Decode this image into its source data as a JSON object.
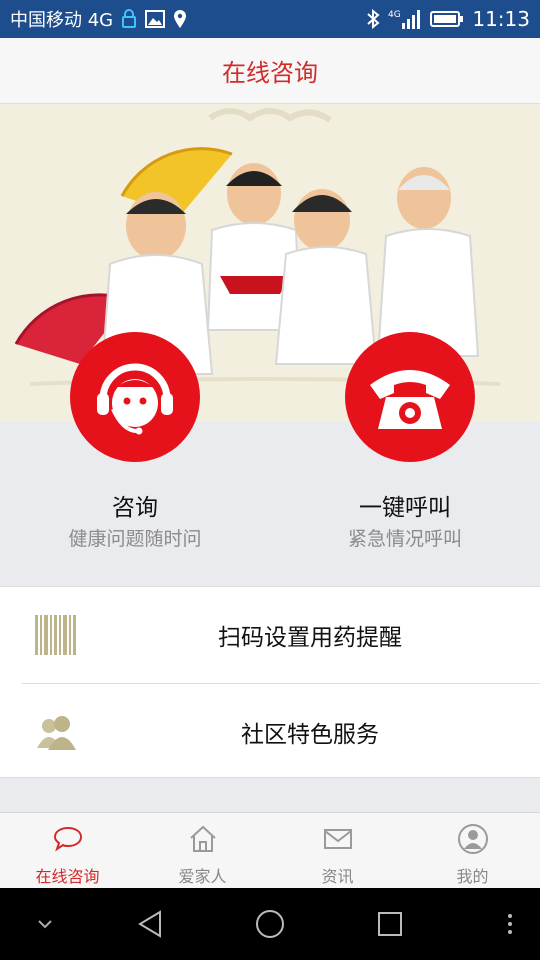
{
  "status_bar": {
    "carrier": "中国移动 4G",
    "signal_label": "4G",
    "time": "11:13",
    "icons": [
      "lock-icon",
      "image-icon",
      "location-icon",
      "bluetooth-icon",
      "signal-icon",
      "battery-icon"
    ]
  },
  "header": {
    "title": "在线咨询"
  },
  "banner": {
    "image": "tai-chi-seniors-illustration"
  },
  "actions": [
    {
      "label": "咨询",
      "sub": "健康问题随时问",
      "icon": "headset-agent-icon"
    },
    {
      "label": "一键呼叫",
      "sub": "紧急情况呼叫",
      "icon": "telephone-icon"
    }
  ],
  "list": [
    {
      "label": "扫码设置用药提醒",
      "icon": "barcode-icon"
    },
    {
      "label": "社区特色服务",
      "icon": "people-icon"
    }
  ],
  "tabs": [
    {
      "label": "在线咨询",
      "icon": "chat-bubble-icon",
      "active": true
    },
    {
      "label": "爱家人",
      "icon": "home-icon",
      "active": false
    },
    {
      "label": "资讯",
      "icon": "mail-icon",
      "active": false
    },
    {
      "label": "我的",
      "icon": "person-icon",
      "active": false
    }
  ],
  "colors": {
    "accent": "#d32a2a",
    "button_red": "#e5121c",
    "status_bar": "#1d4d8c"
  }
}
